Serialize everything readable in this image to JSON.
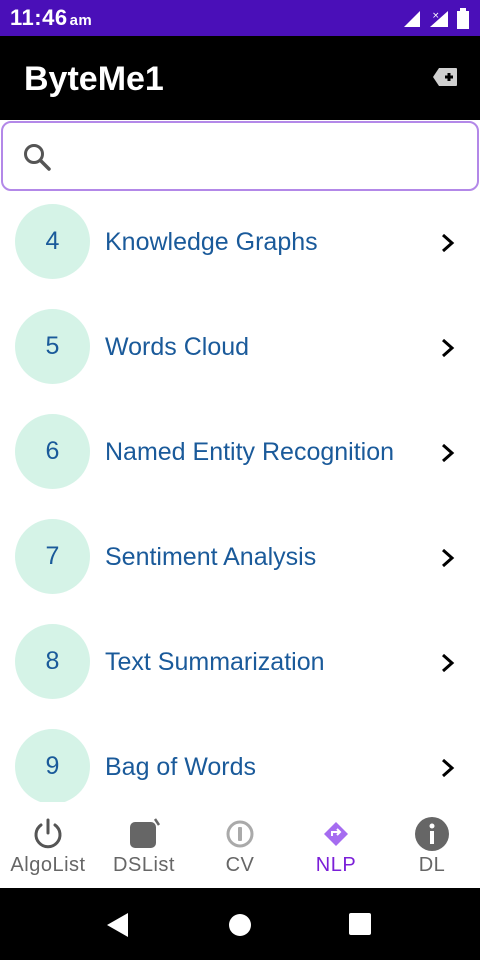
{
  "status_bar": {
    "time": "11:46",
    "ampm": "am",
    "bg": "#4a0fb8"
  },
  "app_bar": {
    "title": "ByteMe1",
    "action_icon": "backspace-plus-icon"
  },
  "search": {
    "placeholder": "",
    "value": "",
    "icon": "search-icon"
  },
  "list": {
    "items": [
      {
        "number": "4",
        "label": "Knowledge Graphs"
      },
      {
        "number": "5",
        "label": "Words Cloud"
      },
      {
        "number": "6",
        "label": "Named Entity Recognition"
      },
      {
        "number": "7",
        "label": "Sentiment Analysis"
      },
      {
        "number": "8",
        "label": "Text Summarization"
      },
      {
        "number": "9",
        "label": "Bag of Words"
      }
    ],
    "badge_color": "#d5f3e7",
    "text_color": "#1a5a9a"
  },
  "bottom_nav": {
    "active": "NLP",
    "items": [
      {
        "label": "AlgoList",
        "icon": "power-icon"
      },
      {
        "label": "DSList",
        "icon": "square-icon"
      },
      {
        "label": "CV",
        "icon": "circle-info-icon"
      },
      {
        "label": "NLP",
        "icon": "diamond-icon"
      },
      {
        "label": "DL",
        "icon": "info-icon"
      }
    ],
    "active_color": "#7b1fd8"
  }
}
